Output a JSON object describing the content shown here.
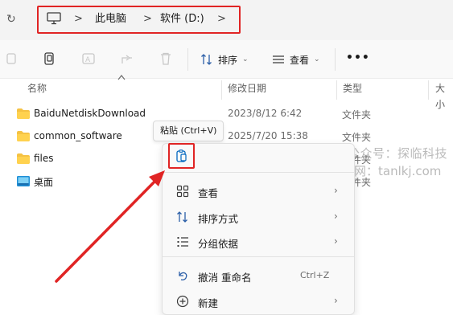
{
  "address": {
    "crumbs": [
      "此电脑",
      "软件 (D:)"
    ],
    "separator": ">"
  },
  "toolbar": {
    "sort_label": "排序",
    "view_label": "查看",
    "more_label": "•••"
  },
  "columns": [
    "名称",
    "修改日期",
    "类型",
    "大小"
  ],
  "rows": [
    {
      "name": "BaiduNetdiskDownload",
      "date": "2023/8/12 6:42",
      "type": "文件夹",
      "icon": "folder-icon"
    },
    {
      "name": "common_software",
      "date": "2025/7/20 15:38",
      "type": "文件夹",
      "icon": "folder-icon"
    },
    {
      "name": "files",
      "date": "",
      "type": "文件夹",
      "icon": "folder-icon"
    },
    {
      "name": "桌面",
      "date": "",
      "type": "文件夹",
      "icon": "desktop-folder-icon"
    }
  ],
  "tooltip": "粘贴 (Ctrl+V)",
  "watermark": {
    "line1": "微信公众号：探临科技",
    "line2": "官网：tanlkj.com"
  },
  "menu": {
    "items": [
      {
        "label": "查看",
        "icon": "grid-icon",
        "arrow": "›"
      },
      {
        "label": "排序方式",
        "icon": "sort-icon",
        "arrow": "›"
      },
      {
        "label": "分组依据",
        "icon": "group-icon",
        "arrow": "›"
      },
      {
        "label": "撤消 重命名",
        "icon": "undo-icon",
        "shortcut": "Ctrl+Z"
      },
      {
        "label": "新建",
        "icon": "new-icon",
        "arrow": "›"
      }
    ]
  },
  "colors": {
    "highlight": "#e02424",
    "folder": "#f5c244",
    "accent": "#0067c0"
  }
}
